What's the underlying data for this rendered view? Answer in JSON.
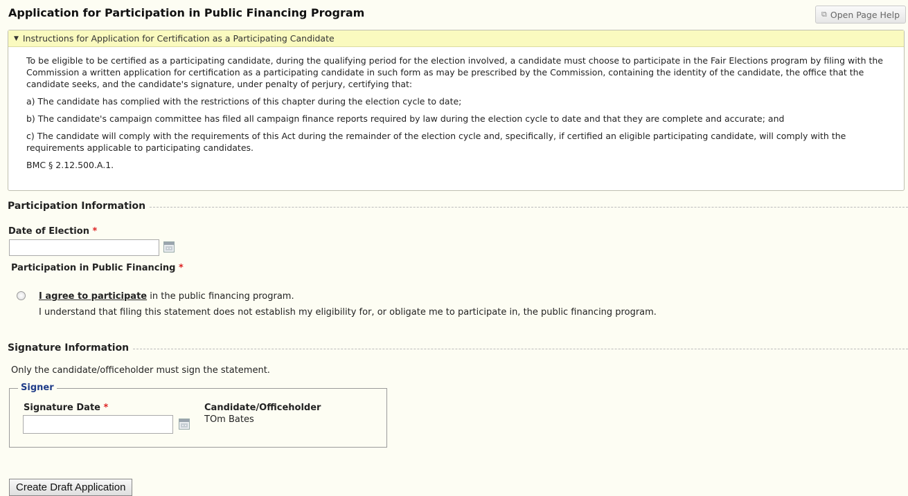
{
  "page": {
    "title": "Application for Participation in Public Financing Program",
    "help_button": "Open Page Help",
    "help_icon": "external-window-icon"
  },
  "instructions": {
    "header": "Instructions for Application for Certification as a Participating Candidate",
    "intro": "To be eligible to be certified as a participating candidate, during the qualifying period for the election involved, a candidate must choose to participate in the Fair Elections program by filing with the Commission a written application for certification as a participating candidate in such form as may be prescribed by the Commission, containing the identity of the candidate, the office that the candidate seeks, and the candidate's signature, under penalty of perjury, certifying that:",
    "item_a": "a) The candidate has complied with the restrictions of this chapter during the election cycle to date;",
    "item_b": "b) The candidate's campaign committee has filed all campaign finance reports required by law during the election cycle to date and that they are complete and accurate; and",
    "item_c": "c) The candidate will comply with the requirements of this Act during the remainder of the election cycle and, specifically, if certified an eligible participating candidate, will comply with the requirements applicable to participating candidates.",
    "citation": "BMC § 2.12.500.A.1."
  },
  "participation": {
    "section_title": "Participation Information",
    "date_label": "Date of Election",
    "date_value": "",
    "financing_label": "Participation in Public Financing",
    "agree_link": "I agree to participate",
    "agree_rest": " in the public financing program.",
    "agree_note": "I understand that filing this statement does not establish my eligibility for, or obligate me to participate in, the public financing program."
  },
  "signature": {
    "section_title": "Signature Information",
    "note": "Only the candidate/officeholder must sign the statement.",
    "legend": "Signer",
    "date_label": "Signature Date",
    "date_value": "",
    "role_label": "Candidate/Officeholder",
    "signer_name": "TOm Bates"
  },
  "actions": {
    "create_label": "Create Draft Application"
  },
  "required_marker": "*"
}
